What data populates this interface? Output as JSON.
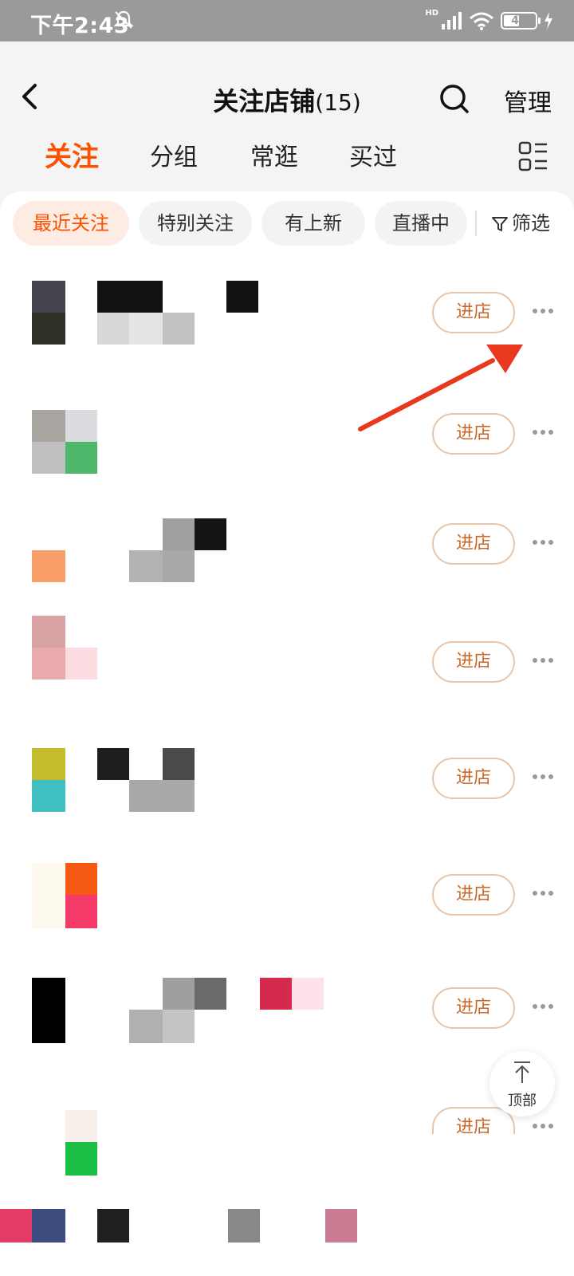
{
  "status_bar": {
    "time": "下午2:43",
    "hd": "HD",
    "battery_level": "45"
  },
  "header": {
    "title": "关注店铺",
    "count": "(15)",
    "manage_label": "管理"
  },
  "tabs": [
    {
      "label": "关注",
      "active": true
    },
    {
      "label": "分组",
      "active": false
    },
    {
      "label": "常逛",
      "active": false
    },
    {
      "label": "买过",
      "active": false
    }
  ],
  "chips": [
    {
      "label": "最近关注",
      "active": true
    },
    {
      "label": "特别关注",
      "active": false
    },
    {
      "label": "有上新",
      "active": false
    },
    {
      "label": "直播中",
      "active": false
    }
  ],
  "filter_label": "筛选",
  "stores": [
    {
      "enter_label": "进店"
    },
    {
      "enter_label": "进店"
    },
    {
      "enter_label": "进店"
    },
    {
      "enter_label": "进店"
    },
    {
      "enter_label": "进店"
    },
    {
      "enter_label": "进店"
    },
    {
      "enter_label": "进店"
    },
    {
      "enter_label": "进店"
    }
  ],
  "back_to_top_label": "顶部",
  "colors": {
    "accent": "#ff5000",
    "enter_text": "#c7692d",
    "annotation_arrow": "#e8391e"
  }
}
